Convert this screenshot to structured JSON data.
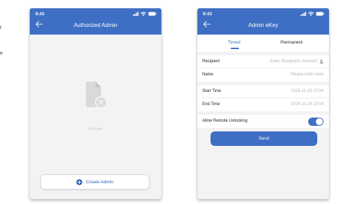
{
  "edge": {
    "line1": "t",
    "line2": "e"
  },
  "left": {
    "status": {
      "time": "9:43"
    },
    "header": {
      "title": "Authorized Admin"
    },
    "empty_text": "No Data",
    "create_button_label": "Create Admin"
  },
  "right": {
    "status": {
      "time": "9:43"
    },
    "header": {
      "title": "Admin eKey"
    },
    "tabs": [
      {
        "label": "Timed",
        "active": true
      },
      {
        "label": "Permanent",
        "active": false
      }
    ],
    "fields": {
      "recipient": {
        "label": "Recipient",
        "placeholder": "Enter Recipient's Account"
      },
      "name": {
        "label": "Name",
        "placeholder": "Please enter here"
      },
      "start": {
        "label": "Start Time",
        "value": "2024-11-19 10:04"
      },
      "end": {
        "label": "End Time",
        "value": "2024-11-24 10:04"
      },
      "remote": {
        "label": "Allow Remote Unlocking",
        "enabled": true
      }
    },
    "send_label": "Send"
  },
  "colors": {
    "accent": "#3e6fc4",
    "background": "#f3f3f4",
    "muted": "#b3b3b3"
  }
}
